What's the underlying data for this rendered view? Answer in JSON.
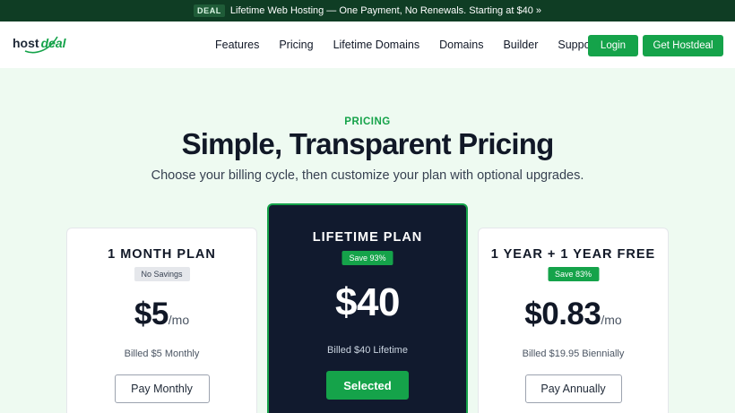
{
  "banner": {
    "tag": "DEAL",
    "text": "Lifetime Web Hosting — One Payment, No Renewals. Starting at $40 »"
  },
  "logo": {
    "part1": "host",
    "part2": "deal",
    "icon": "swoosh-logo-icon"
  },
  "nav": {
    "items": [
      "Features",
      "Pricing",
      "Lifetime Domains",
      "Domains",
      "Builder",
      "Support"
    ],
    "login": "Login",
    "cta": "Get Hostdeal"
  },
  "hero": {
    "eyebrow": "PRICING",
    "title": "Simple, Transparent Pricing",
    "subtitle": "Choose your billing cycle, then customize your plan with optional upgrades."
  },
  "plans": [
    {
      "name": "1 MONTH PLAN",
      "badge": "No Savings",
      "price": "$5",
      "period": "/mo",
      "billed": "Billed $5 Monthly",
      "button": "Pay Monthly"
    },
    {
      "name": "LIFETIME PLAN",
      "badge": "Save 93%",
      "price": "$40",
      "period": "",
      "billed": "Billed $40 Lifetime",
      "button": "Selected"
    },
    {
      "name": "1 YEAR + 1 YEAR FREE",
      "badge": "Save 83%",
      "price": "$0.83",
      "period": "/mo",
      "billed": "Billed $19.95 Biennially",
      "button": "Pay Annually"
    }
  ],
  "colors": {
    "accent": "#15a34a",
    "banner_bg": "#0f3d24",
    "featured_bg": "#111a2e",
    "page_bg": "#eefaf1"
  }
}
